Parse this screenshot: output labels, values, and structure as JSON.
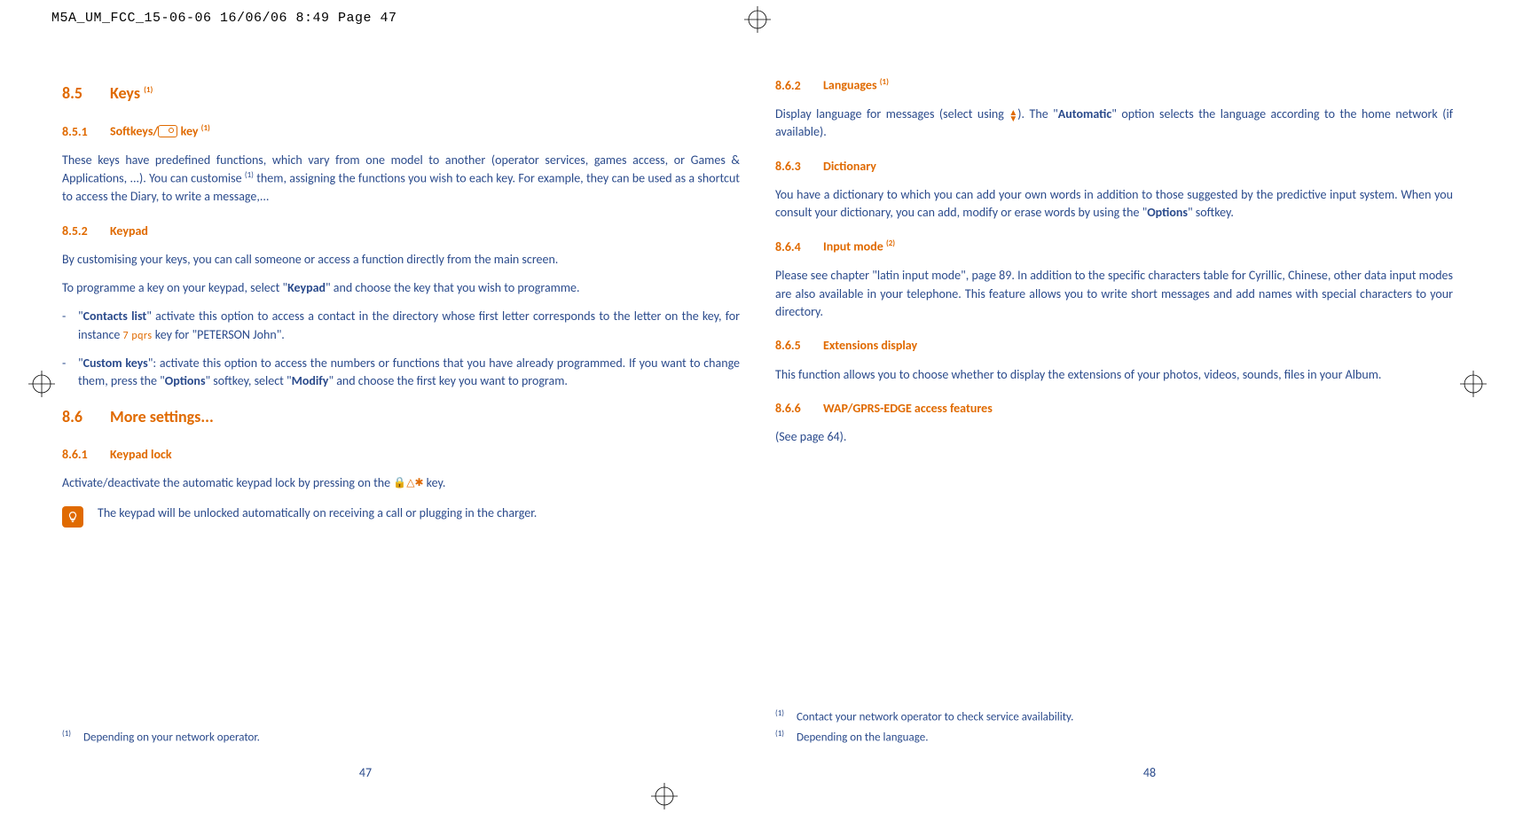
{
  "header": "M5A_UM_FCC_15-06-06  16/06/06  8:49  Page 47",
  "left": {
    "sec85_num": "8.5",
    "sec85_title": "Keys ",
    "sec85_sup": "(1)",
    "s851_num": "8.5.1",
    "s851_title": "Softkeys/",
    "s851_title2": " key ",
    "s851_sup": "(1)",
    "p851": "These keys have predefined functions, which vary from one model to another (operator services, games access, or Games & Applications, ...). You can customise ",
    "p851_sup": "(1)",
    "p851b": " them, assigning the functions you wish to each key. For example, they can be used as a shortcut to access the Diary, to write a message,...",
    "s852_num": "8.5.2",
    "s852_title": "Keypad",
    "p852a": "By customising your keys, you can call someone or access a function directly from the main screen.",
    "p852b_a": "To programme a key on your keypad, select \"",
    "p852b_b": "Keypad",
    "p852b_c": "\" and choose the key that you wish to programme.",
    "bul1_a": "\"",
    "bul1_b": "Contacts list",
    "bul1_c": "\" activate this option to access a contact in the directory whose first letter corresponds to the letter on the key, for instance ",
    "bul1_key": "7 pqrs",
    "bul1_d": " key for \"PETERSON John\".",
    "bul2_a": "\"",
    "bul2_b": "Custom keys",
    "bul2_c": "\": activate this option to access the numbers or functions that you have already programmed. If you want to change them, press the \"",
    "bul2_d": "Options",
    "bul2_e": "\" softkey, select \"",
    "bul2_f": "Modify",
    "bul2_g": "\" and choose the first key you want to program.",
    "sec86_num": "8.6",
    "sec86_title": "More settings...",
    "s861_num": "8.6.1",
    "s861_title": "Keypad lock",
    "p861_a": "Activate/deactivate the automatic keypad lock by pressing on the ",
    "p861_b": " key.",
    "note861": "The keypad will be unlocked automatically on receiving a call or plugging in the charger.",
    "fn1_sup": "(1)",
    "fn1": "Depending on your network operator.",
    "page_num": "47"
  },
  "right": {
    "s862_num": "8.6.2",
    "s862_title": "Languages ",
    "s862_sup": "(1)",
    "p862_a": "Display language for messages (select using ",
    "p862_b": "). The \"",
    "p862_c": "Automatic",
    "p862_d": "\" option selects the language according to the home network (if available).",
    "s863_num": "8.6.3",
    "s863_title": "Dictionary",
    "p863_a": "You have a dictionary to which you can add your own words in addition to those suggested by the predictive input system. When you consult your dictionary, you can add, modify or erase words by using the \"",
    "p863_b": "Options",
    "p863_c": "\" softkey.",
    "s864_num": "8.6.4",
    "s864_title": "Input mode ",
    "s864_sup": "(2)",
    "p864": "Please see chapter \"latin input mode\", page 89. In addition to the specific characters table for Cyrillic, Chinese, other data input modes are also available in your telephone. This feature allows you to write short messages and add names with special characters to your directory.",
    "s865_num": "8.6.5",
    "s865_title": "Extensions display",
    "p865": "This function allows you to choose whether to display the extensions of your photos, videos, sounds, files in your Album.",
    "s866_num": "8.6.6",
    "s866_title": "WAP/GPRS-EDGE access features",
    "p866": "(See page 64).",
    "fn1_sup": "(1)",
    "fn1": "Contact your network operator to check service availability.",
    "fn2_sup": "(1)",
    "fn2": "Depending on the language.",
    "page_num": "48"
  }
}
